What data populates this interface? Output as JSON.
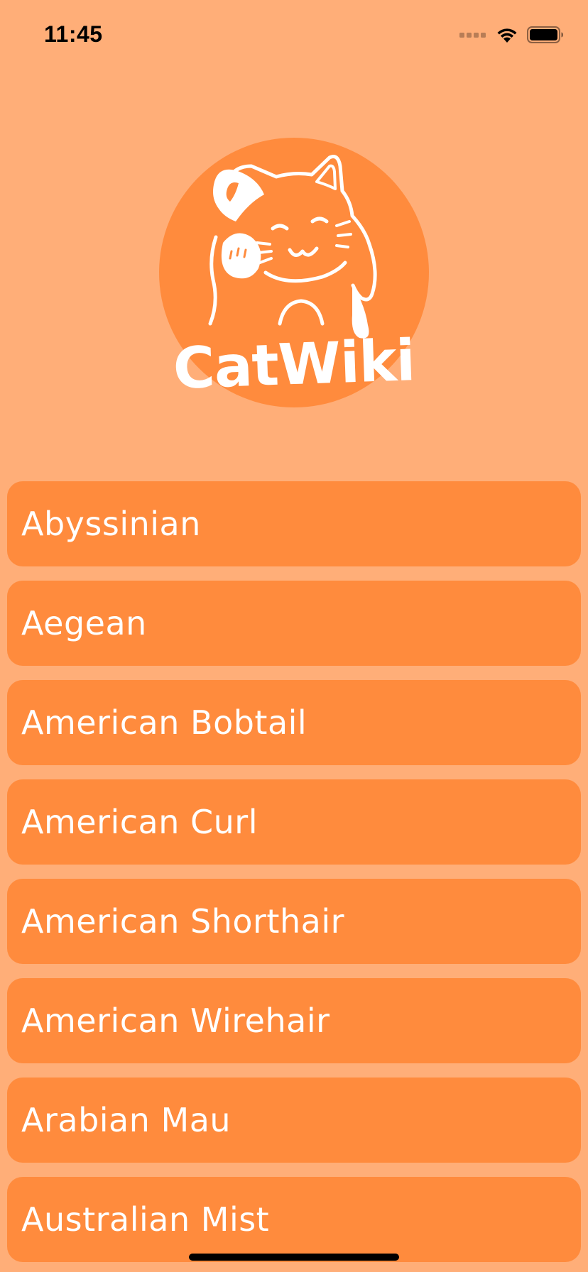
{
  "status_bar": {
    "time": "11:45"
  },
  "logo": {
    "text": "CatWiki",
    "icon": "cat-icon"
  },
  "breeds": [
    {
      "label": "Abyssinian"
    },
    {
      "label": "Aegean"
    },
    {
      "label": "American Bobtail"
    },
    {
      "label": "American Curl"
    },
    {
      "label": "American Shorthair"
    },
    {
      "label": "American Wirehair"
    },
    {
      "label": "Arabian Mau"
    },
    {
      "label": "Australian Mist"
    }
  ],
  "colors": {
    "background": "#FFAE78",
    "accent": "#FF8B3D",
    "text": "#FFFFFF"
  }
}
